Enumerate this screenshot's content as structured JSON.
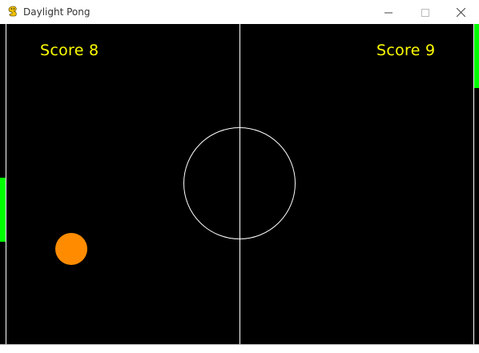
{
  "window": {
    "title": "Daylight Pong",
    "app_icon": "pygame-snake-icon",
    "controls": {
      "minimize_icon": "minimize-icon",
      "maximize_icon": "maximize-icon",
      "close_icon": "close-icon"
    }
  },
  "game": {
    "left_score_label": "Score 8",
    "right_score_label": "Score 9",
    "colors": {
      "background": "#000000",
      "lines": "#ffffff",
      "paddles": "#00ff00",
      "ball": "#ff8c00",
      "score_text": "#ffff00"
    }
  }
}
